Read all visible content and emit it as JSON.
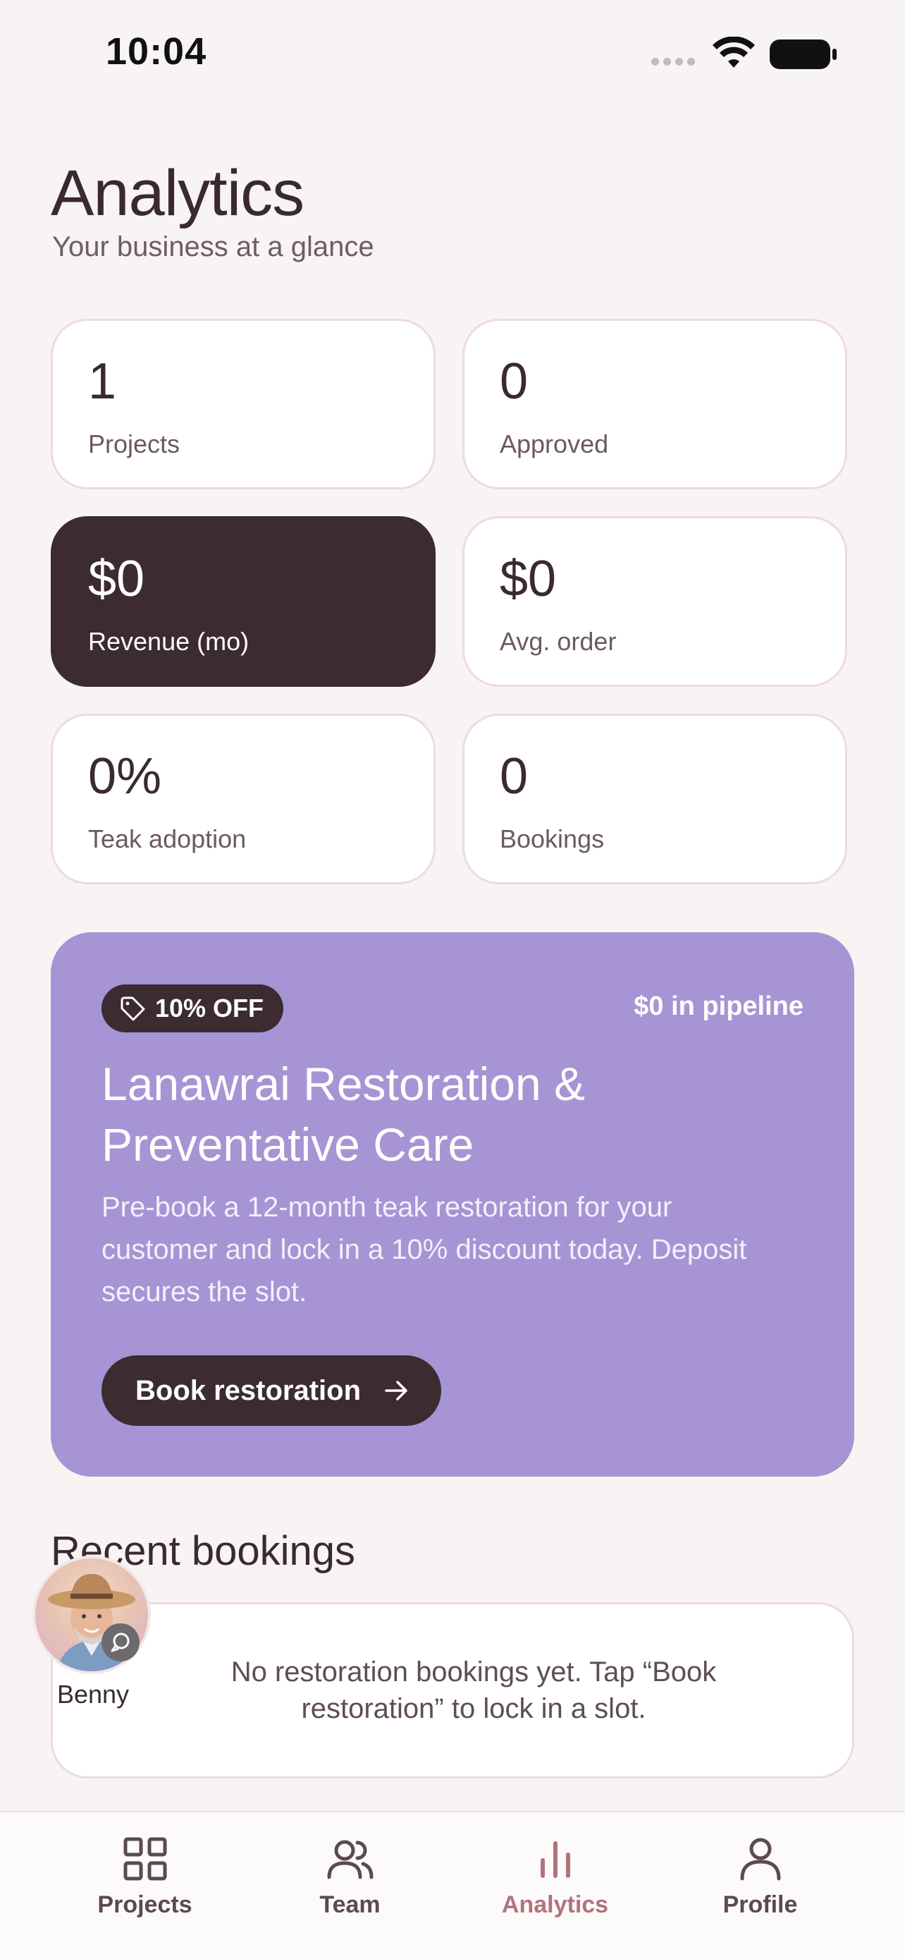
{
  "status_bar": {
    "time": "10:04"
  },
  "header": {
    "title": "Analytics",
    "subtitle": "Your business at a glance"
  },
  "stats": [
    {
      "value": "1",
      "label": "Projects"
    },
    {
      "value": "0",
      "label": "Approved"
    },
    {
      "value": "$0",
      "label": "Revenue (mo)",
      "highlighted": true
    },
    {
      "value": "$0",
      "label": "Avg. order"
    },
    {
      "value": "0%",
      "label": "Teak adoption"
    },
    {
      "value": "0",
      "label": "Bookings"
    }
  ],
  "promo": {
    "badge": "10% OFF",
    "pipeline": "$0 in pipeline",
    "title": "Lanawrai Restoration & Preventative Care",
    "description": "Pre-book a 12-month teak restoration for your customer and lock in a 10% discount today. Deposit secures the slot.",
    "button_label": "Book restoration",
    "background_color": "#a694d4"
  },
  "recent_bookings": {
    "title": "Recent bookings",
    "empty_message": "No restoration bookings yet. Tap “Book restoration” to lock in a slot."
  },
  "assistant": {
    "name": "Benny"
  },
  "tabs": [
    {
      "label": "Projects",
      "icon": "grid-icon"
    },
    {
      "label": "Team",
      "icon": "people-icon"
    },
    {
      "label": "Analytics",
      "icon": "bar-chart-icon",
      "active": true
    },
    {
      "label": "Profile",
      "icon": "person-icon"
    }
  ],
  "colors": {
    "background": "#f8f4f3",
    "dark": "#3c2b30",
    "accent": "#b2737c"
  }
}
